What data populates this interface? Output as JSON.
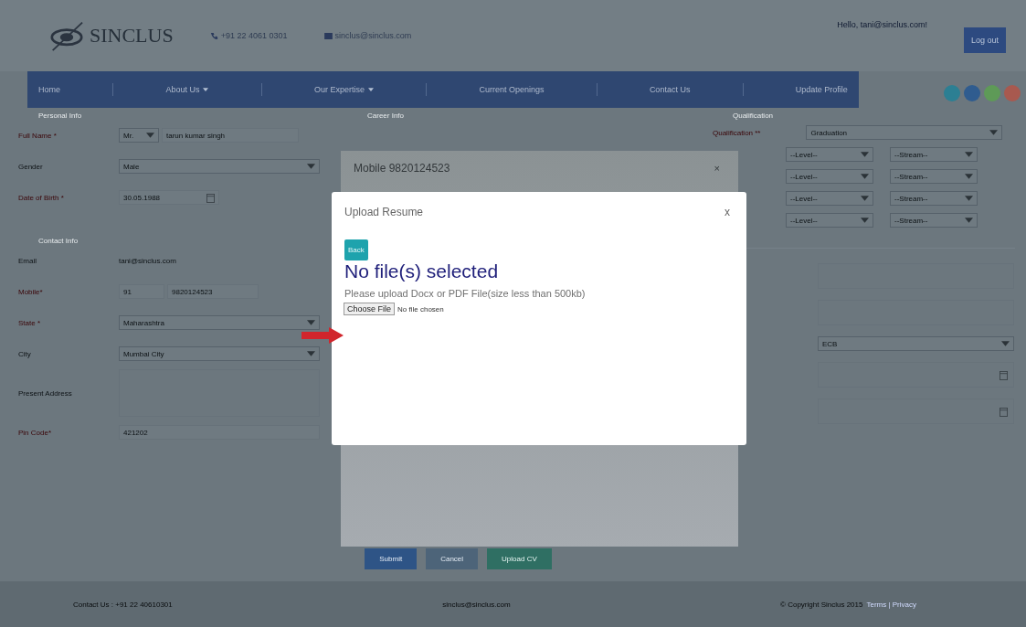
{
  "header": {
    "logo": "SINCLUS",
    "phone": "+91 22 4061 0301",
    "email": "sinclus@sinclus.com",
    "greeting": "Hello, tani@sinclus.com!",
    "logout": "Log out"
  },
  "nav": [
    {
      "label": "Home",
      "dropdown": false
    },
    {
      "label": "About Us",
      "dropdown": true
    },
    {
      "label": "Our Expertise",
      "dropdown": true
    },
    {
      "label": "Current Openings",
      "dropdown": false
    },
    {
      "label": "Contact Us",
      "dropdown": false
    },
    {
      "label": "Update Profile",
      "dropdown": false
    }
  ],
  "social": [
    {
      "color": "#2c7f93"
    },
    {
      "color": "#2f5c8f"
    },
    {
      "color": "#5e9a57"
    },
    {
      "color": "#a8594f"
    }
  ],
  "personal": {
    "legend": "Personal Info",
    "rows": [
      {
        "label": "Full Name *",
        "required": true,
        "kind": "name",
        "prefix": "Mr.",
        "value": "tarun kumar singh"
      },
      {
        "label": "Gender",
        "required": false,
        "kind": "select",
        "value": "Male"
      },
      {
        "label": "Date of Birth *",
        "required": true,
        "kind": "date",
        "value": "30.05.1988"
      }
    ]
  },
  "contact": {
    "legend": "Contact Info",
    "rows": [
      {
        "label": "Email",
        "required": false,
        "kind": "text",
        "value": "tani@sinclus.com"
      },
      {
        "label": "Mobile*",
        "required": true,
        "kind": "phone",
        "prefix": "91",
        "value": "9820124523"
      },
      {
        "label": "State *",
        "required": true,
        "kind": "select",
        "value": "Maharashtra"
      },
      {
        "label": "City",
        "required": false,
        "kind": "select",
        "value": "Mumbai City"
      },
      {
        "label": "Present Address",
        "required": false,
        "kind": "area"
      },
      {
        "label": "Pin Code*",
        "required": true,
        "kind": "input",
        "value": "421202"
      }
    ]
  },
  "career": {
    "legend": "Career Info"
  },
  "qualification": {
    "legend": "Qualification",
    "label": "Qualification **",
    "value": "Graduation",
    "pairs": [
      {
        "level": "--Level--",
        "stream": "--Stream--"
      },
      {
        "level": "--Level--",
        "stream": "--Stream--"
      },
      {
        "level": "--Level--",
        "stream": "--Stream--"
      },
      {
        "level": "--Level--",
        "stream": "--Stream--"
      }
    ],
    "fields": [
      {
        "kind": "area"
      },
      {
        "kind": "area"
      },
      {
        "kind": "select",
        "value": "ECB"
      },
      {
        "kind": "date"
      },
      {
        "kind": "date"
      }
    ]
  },
  "buttons": [
    {
      "label": "Submit",
      "kind": "primary"
    },
    {
      "label": "Cancel",
      "kind": "secondary"
    },
    {
      "label": "Upload CV",
      "kind": "success"
    }
  ],
  "footer": {
    "contact": "Contact Us : +91 22 40610301",
    "email": "sinclus@sinclus.com",
    "copyright": "© Copyright Sinclus 2015",
    "links": "Terms | Privacy"
  },
  "mobile_modal": {
    "title": "Mobile 9820124523",
    "close": "×"
  },
  "upload_modal": {
    "title": "Upload Resume",
    "close": "x",
    "back": "Back",
    "heading": "No file(s) selected",
    "hint": "Please upload Docx or PDF File(size less than 500kb)",
    "choose": "Choose File",
    "status": "No file chosen"
  }
}
